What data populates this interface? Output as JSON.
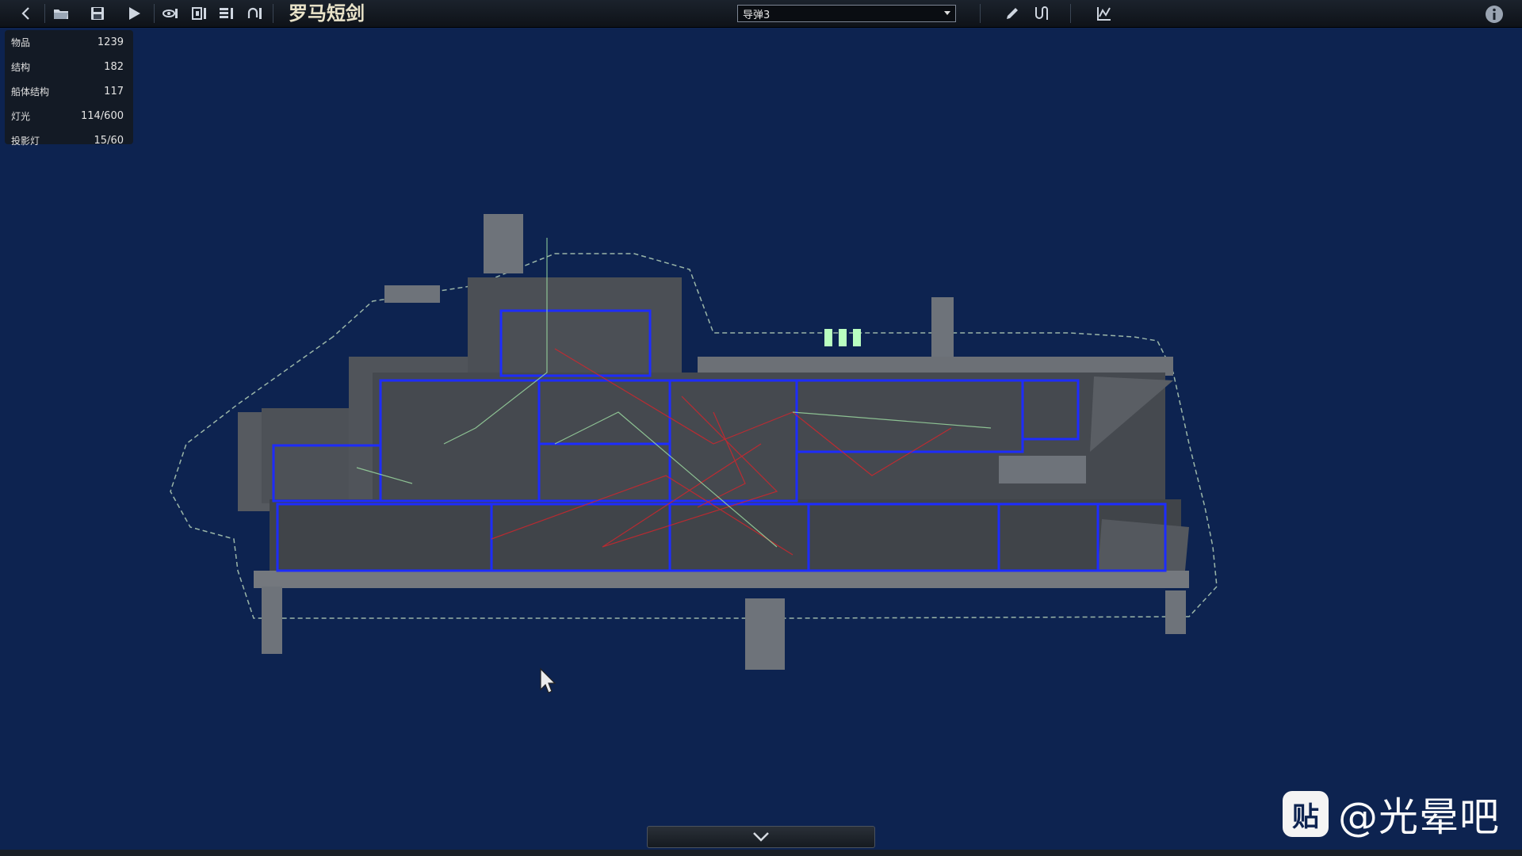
{
  "toolbar": {
    "submarine_name": "罗马短剑",
    "preset_selected": "导弹3"
  },
  "stats": [
    {
      "label": "物品",
      "value": "1239"
    },
    {
      "label": "结构",
      "value": "182"
    },
    {
      "label": "船体结构",
      "value": "117"
    },
    {
      "label": "灯光",
      "value": "114/600"
    },
    {
      "label": "投影灯",
      "value": "15/60"
    }
  ],
  "watermark": {
    "logo_text": "贴",
    "text": "@光晕吧"
  },
  "colors": {
    "background": "#0d2350",
    "room_outline": "#1d2cff",
    "wire_red": "#d8242b",
    "wire_green": "#9fe0a4"
  },
  "icons": [
    "back-icon",
    "open-folder-icon",
    "save-icon",
    "play-icon",
    "visibility-icon",
    "layer-icon",
    "list-icon",
    "undo-icon",
    "pencil-icon",
    "wire-icon",
    "graph-icon",
    "info-icon",
    "chevron-down-icon"
  ]
}
